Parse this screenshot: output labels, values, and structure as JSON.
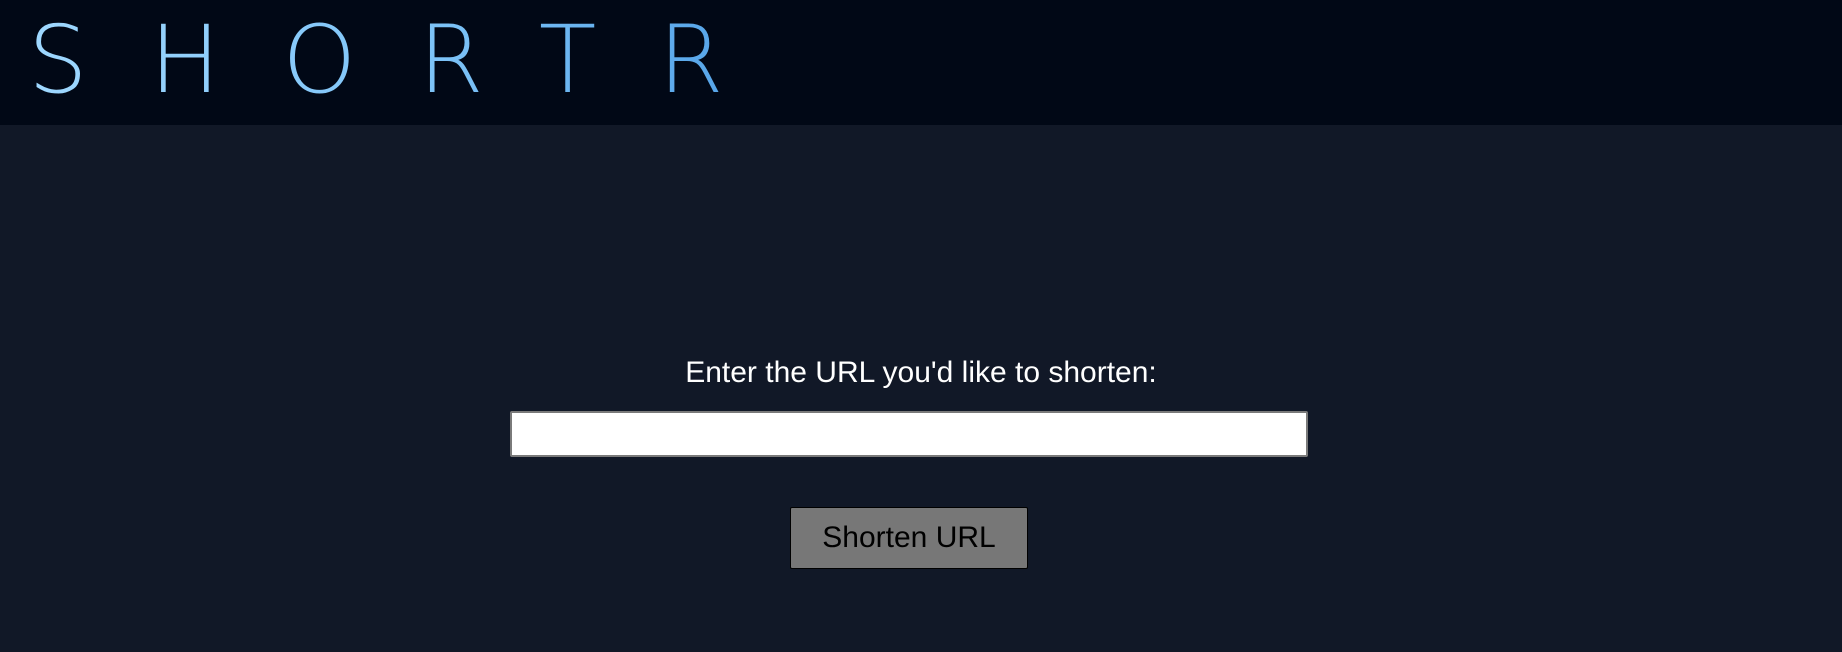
{
  "header": {
    "logo_text": "SHORTR"
  },
  "form": {
    "prompt": "Enter the URL you'd like to shorten:",
    "input_value": "",
    "input_placeholder": "",
    "submit_label": "Shorten URL"
  },
  "colors": {
    "header_background": "#010816",
    "page_background": "#111827",
    "logo_gradient_start": "#9fd8ff",
    "logo_gradient_end": "#4f9fe6",
    "button_background": "#777777"
  }
}
